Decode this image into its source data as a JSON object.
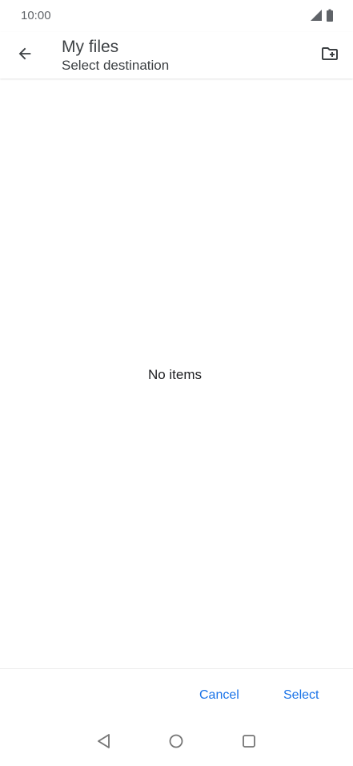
{
  "status_bar": {
    "time": "10:00",
    "icons": [
      "cell-signal-icon",
      "battery-icon"
    ]
  },
  "app_bar": {
    "back_icon": "arrow-back-icon",
    "title": "My files",
    "subtitle": "Select destination",
    "new_folder_icon": "new-folder-icon"
  },
  "content": {
    "empty_message": "No items"
  },
  "actions": {
    "cancel_label": "Cancel",
    "select_label": "Select"
  },
  "nav_bar": {
    "icons": [
      "nav-back-icon",
      "nav-home-icon",
      "nav-recents-icon"
    ]
  },
  "colors": {
    "accent": "#1a73e8",
    "text_primary": "#202124",
    "text_secondary": "#5f6368"
  }
}
